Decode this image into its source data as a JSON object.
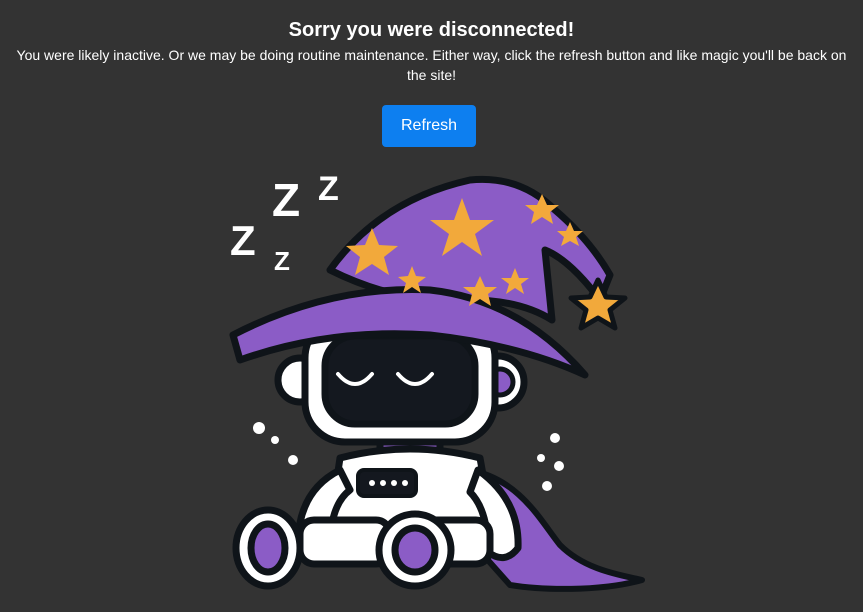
{
  "heading": "Sorry you were disconnected!",
  "message": "You were likely inactive. Or we may be doing routine maintenance. Either way, click the refresh button and like magic you'll be back on the site!",
  "refresh_label": "Refresh",
  "illustration": {
    "sleep_text": "Z",
    "colors": {
      "background": "#333333",
      "button": "#0d7ff0",
      "hat": "#8b5cc6",
      "star": "#f2a93b",
      "robot_body": "#ffffff",
      "visor": "#14181f",
      "outline": "#0f1419"
    }
  }
}
